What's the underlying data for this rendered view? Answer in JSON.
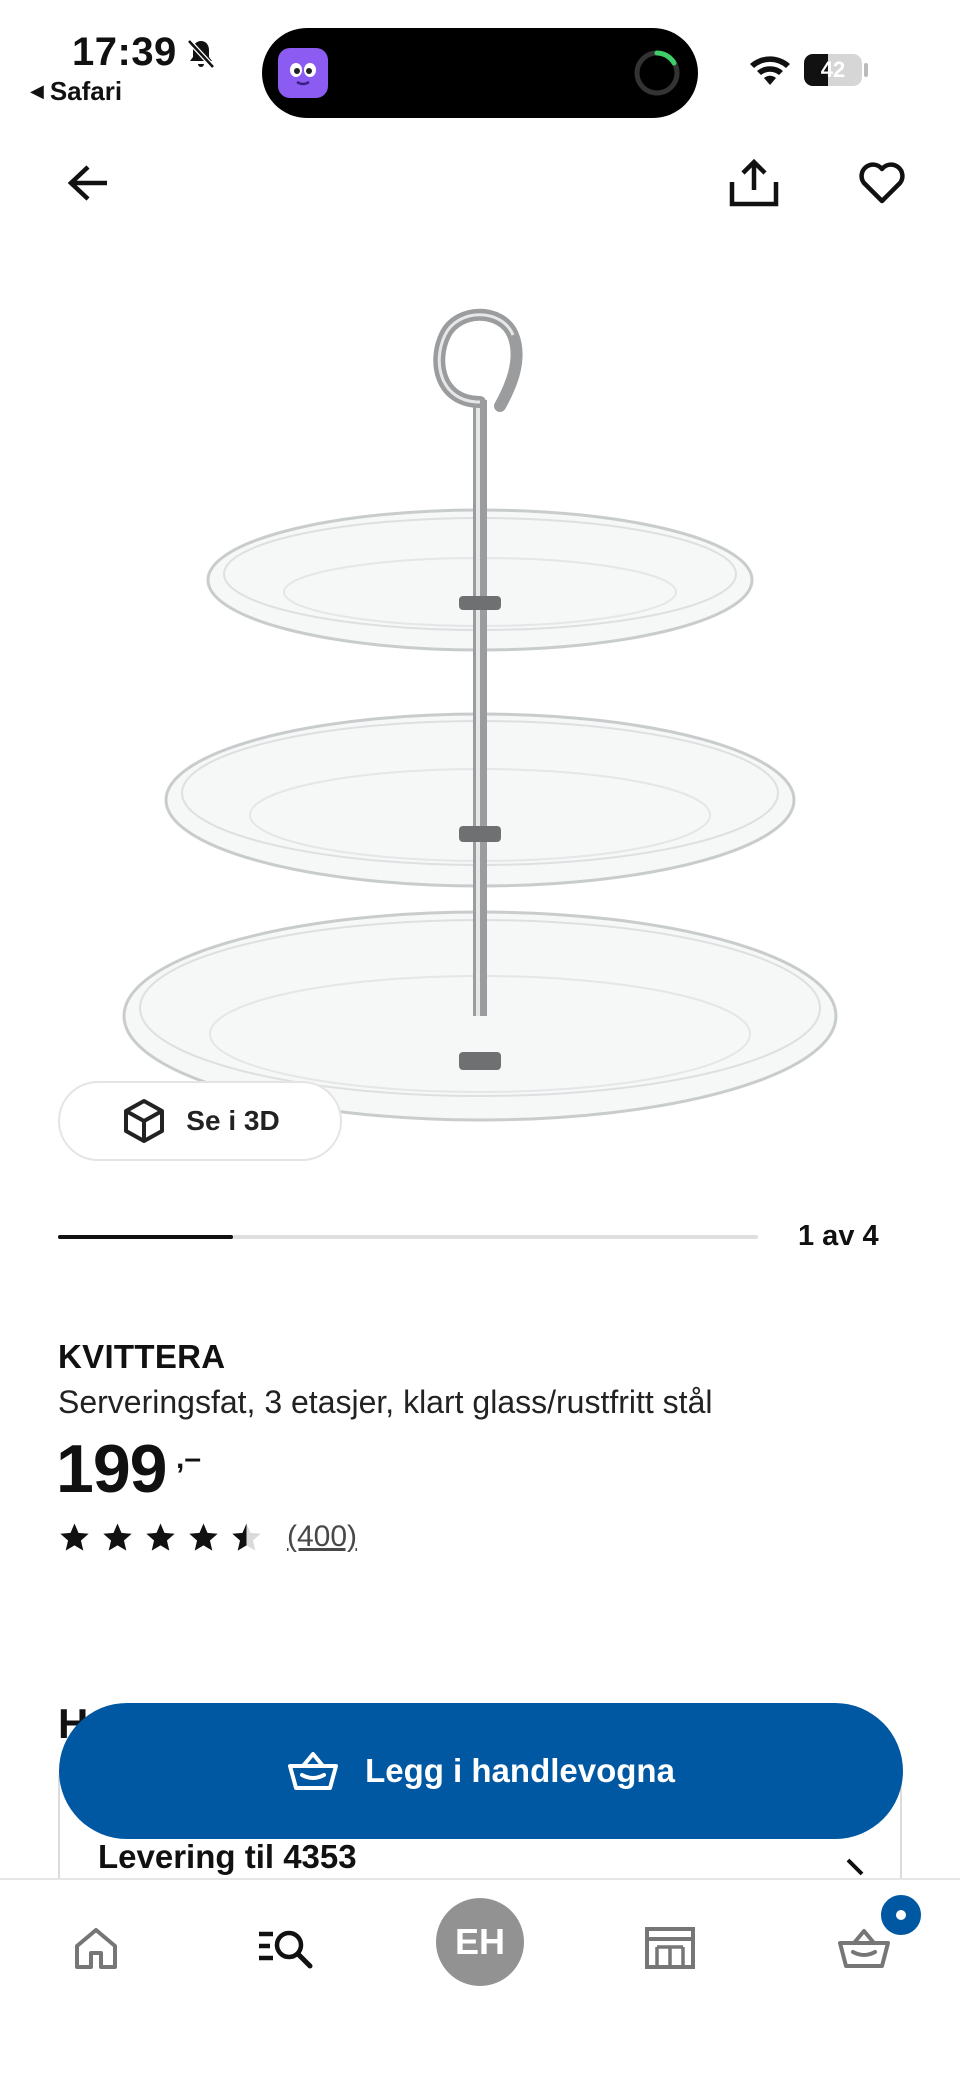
{
  "status_bar": {
    "time": "17:39",
    "back_app": "Safari",
    "battery_level": "42",
    "battery_percent": 42
  },
  "product": {
    "name": "KVITTERA",
    "description": "Serveringsfat, 3 etasjer, klart glass/rustfritt stål",
    "price": "199",
    "price_suffix": ",–",
    "rating": 4.5,
    "review_count": "(400)"
  },
  "gallery": {
    "see_3d_label": "Se i 3D",
    "position_label": "1 av 4",
    "progress_fraction": 0.25
  },
  "actions": {
    "add_to_cart_label": "Legg i handlevogna"
  },
  "delivery": {
    "heading_peek": "H",
    "label": "Levering til 4353"
  },
  "bottom_nav": {
    "avatar_initials": "EH"
  },
  "colors": {
    "brand_blue": "#0058a3",
    "avatar_gray": "#929292",
    "text": "#111111"
  },
  "icons": {
    "top_bar": [
      "arrow-left-icon",
      "share-icon",
      "heart-icon"
    ],
    "bottom_nav": [
      "home-icon",
      "search-icon",
      "profile-avatar",
      "store-icon",
      "cart-icon"
    ]
  }
}
